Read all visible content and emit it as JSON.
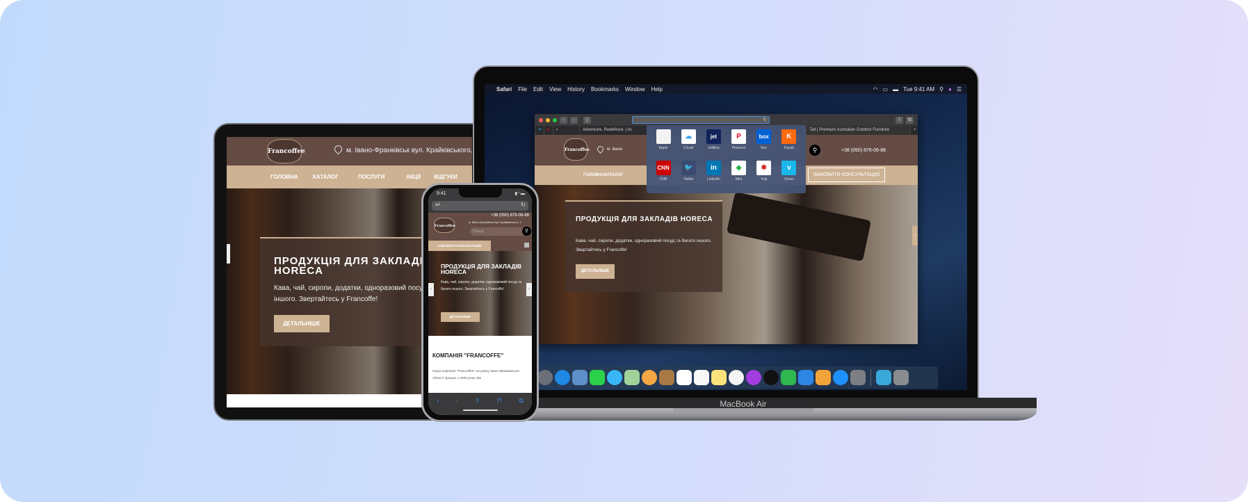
{
  "macbook": {
    "label": "MacBook Air",
    "menubar": {
      "items": [
        "Safari",
        "File",
        "Edit",
        "View",
        "History",
        "Bookmarks",
        "Window",
        "Help"
      ],
      "time": "Tue 9:41 AM"
    },
    "safari": {
      "tabs": [
        "Adventure, Redefined. | Ac",
        "Tait | Premium Australian Outdoor Furniture"
      ],
      "favorites": [
        {
          "label": "Apple",
          "icon": "apple-icon",
          "color": "#f2f2f2",
          "glyph": ""
        },
        {
          "label": "iCloud",
          "icon": "icloud-icon",
          "color": "#ffffff",
          "glyph": "☁"
        },
        {
          "label": "JetBlue",
          "icon": "jetblue-icon",
          "color": "#10245a",
          "glyph": "jet"
        },
        {
          "label": "Pinterest",
          "icon": "pinterest-icon",
          "color": "#ffffff",
          "glyph": "P"
        },
        {
          "label": "Box",
          "icon": "box-icon",
          "color": "#0061d5",
          "glyph": "box"
        },
        {
          "label": "Kayak",
          "icon": "kayak-icon",
          "color": "#ff690f",
          "glyph": "K"
        },
        {
          "label": "CNN",
          "icon": "cnn-icon",
          "color": "#cc0000",
          "glyph": "CNN"
        },
        {
          "label": "Twitter",
          "icon": "twitter-icon",
          "color": "#3a4a70",
          "glyph": "🐦"
        },
        {
          "label": "LinkedIn",
          "icon": "linkedin-icon",
          "color": "#0077b5",
          "glyph": "in"
        },
        {
          "label": "Mint",
          "icon": "mint-icon",
          "color": "#ffffff",
          "glyph": "◆"
        },
        {
          "label": "Yelp",
          "icon": "yelp-icon",
          "color": "#ffffff",
          "glyph": "✱"
        },
        {
          "label": "Vimeo",
          "icon": "vimeo-icon",
          "color": "#1ab7ea",
          "glyph": "v"
        }
      ]
    },
    "dock": [
      {
        "icon": "launchpad-icon",
        "color": "#6b6f78"
      },
      {
        "icon": "safari-icon",
        "color": "#1e88e5"
      },
      {
        "icon": "preview-icon",
        "color": "#5d8fc9"
      },
      {
        "icon": "facetime-icon",
        "color": "#2bd14a"
      },
      {
        "icon": "messages-icon",
        "color": "#38b6f5"
      },
      {
        "icon": "maps-icon",
        "color": "#9fd39a"
      },
      {
        "icon": "photos-icon",
        "color": "#f4a742"
      },
      {
        "icon": "contacts-icon",
        "color": "#a97945"
      },
      {
        "icon": "calendar-icon",
        "color": "#ffffff"
      },
      {
        "icon": "reminders-icon",
        "color": "#f8f8f8"
      },
      {
        "icon": "notes-icon",
        "color": "#f9e27a"
      },
      {
        "icon": "music-icon",
        "color": "#f4f4f4"
      },
      {
        "icon": "podcasts-icon",
        "color": "#a23ee0"
      },
      {
        "icon": "tv-icon",
        "color": "#111111"
      },
      {
        "icon": "numbers-icon",
        "color": "#2eb84f"
      },
      {
        "icon": "keynote-icon",
        "color": "#2d86e4"
      },
      {
        "icon": "pages-icon",
        "color": "#f2a33a"
      },
      {
        "icon": "app-store-icon",
        "color": "#1e90ff"
      },
      {
        "icon": "system-preferences-icon",
        "color": "#7d7f85"
      },
      {
        "icon": "downloads-folder-icon",
        "color": "#3aa8d8"
      },
      {
        "icon": "trash-icon",
        "color": "#8a8c90"
      }
    ]
  },
  "site": {
    "logo": "Francoffee",
    "address": "м. Івано-Франківськ вул. Крайківського, 2",
    "address_short": "м. Івано",
    "phone": "+38 (050) 876-06-88",
    "nav": [
      "ГОЛОВНА",
      "КАТАЛОГ",
      "ПОСЛУГИ",
      "АКЦІЇ",
      "ВІДГУКИ"
    ],
    "consult": "ЗАМОВИТИ КОНСУЛЬТАЦІЮ",
    "search_placeholder": "Пошук",
    "hero_title": "ПРОДУКЦІЯ ДЛЯ ЗАКЛАДІВ HORECA",
    "hero_text": "Кава, чай, сиропи, додатки, одноразовий посуд та багато іншого. Звертайтесь у Francoffe!",
    "hero_button": "ДЕТАЛЬНІШЕ",
    "company_title": "КОМПАНІЯ \"FRANCOFFE\"",
    "company_text": "Наша компанія \"Francoffee\" на ринку Івано-Франківської області працює з 2005 року. Ми"
  },
  "iphone": {
    "time": "9:41",
    "url_label": "aA"
  }
}
